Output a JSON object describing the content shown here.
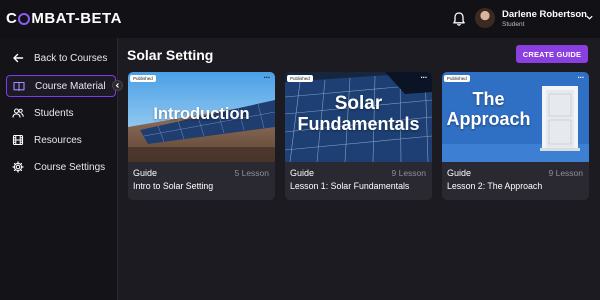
{
  "app": {
    "logo_pre": "C",
    "logo_post": "MBAT-BETA"
  },
  "user": {
    "name": "Darlene Robertson",
    "role": "Student"
  },
  "sidebar": {
    "items": [
      {
        "label": "Back to Courses",
        "icon": "arrow-left-icon"
      },
      {
        "label": "Course Material",
        "icon": "book-icon",
        "active": true
      },
      {
        "label": "Students",
        "icon": "users-icon"
      },
      {
        "label": "Resources",
        "icon": "film-icon"
      },
      {
        "label": "Course Settings",
        "icon": "gear-icon"
      }
    ]
  },
  "main": {
    "title": "Solar Setting",
    "create_label": "CREATE GUIDE"
  },
  "cards": [
    {
      "badge": "Published",
      "thumb_title": "Introduction",
      "kind": "Guide",
      "count": "5 Lesson",
      "title": "Intro to Solar Setting"
    },
    {
      "badge": "Published",
      "thumb_title_1": "Solar",
      "thumb_title_2": "Fundamentals",
      "kind": "Guide",
      "count": "9 Lesson",
      "title": "Lesson 1: Solar Fundamentals"
    },
    {
      "badge": "Published",
      "thumb_title_1": "The",
      "thumb_title_2": "Approach",
      "kind": "Guide",
      "count": "9 Lesson",
      "title": "Lesson 2: The Approach"
    }
  ],
  "colors": {
    "accent": "#8b3fe0",
    "background": "#1c1b21",
    "card": "#2a2932"
  }
}
